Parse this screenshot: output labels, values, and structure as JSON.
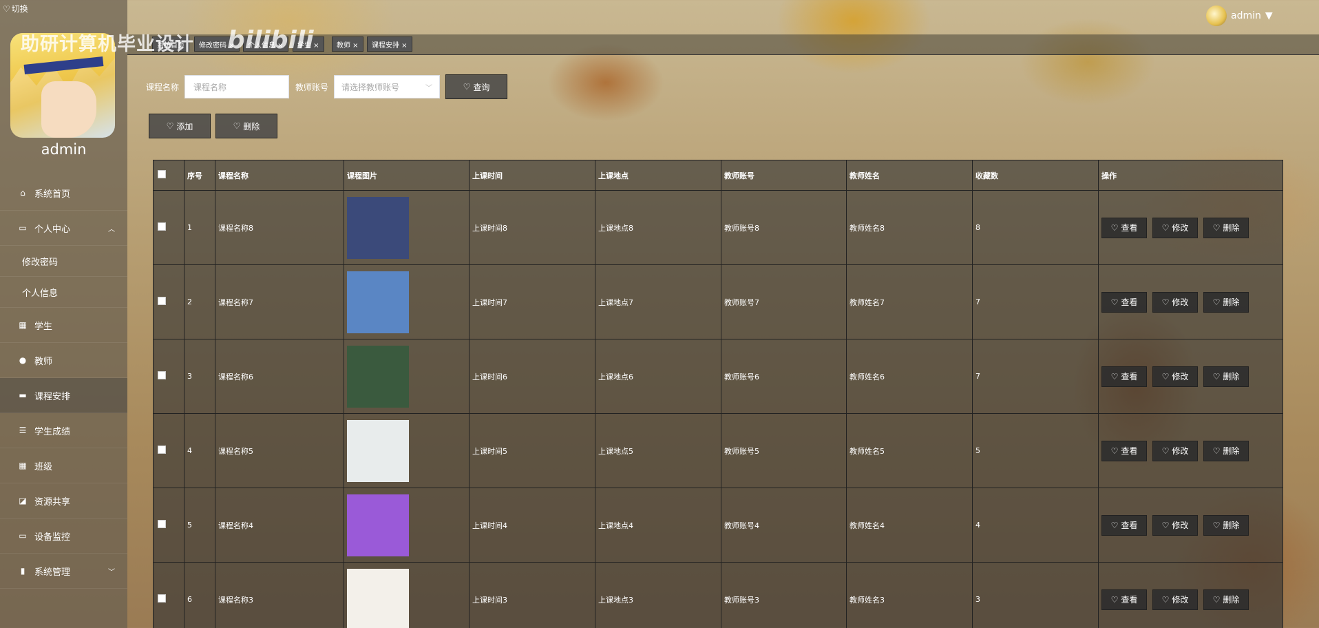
{
  "app": {
    "switch_label": "切换",
    "brand_title": "助研计算机毕业设计",
    "brand_mark": "bilibili",
    "user": "admin"
  },
  "sidebar": {
    "username": "admin",
    "items": [
      {
        "label": "系统首页",
        "icon": "home-icon"
      },
      {
        "label": "个人中心",
        "icon": "card-icon"
      },
      {
        "label": "修改密码",
        "icon": ""
      },
      {
        "label": "个人信息",
        "icon": ""
      },
      {
        "label": "学生",
        "icon": "grid-icon"
      },
      {
        "label": "教师",
        "icon": "person-icon"
      },
      {
        "label": "课程安排",
        "icon": "chat-icon"
      },
      {
        "label": "学生成绩",
        "icon": "sliders-icon"
      },
      {
        "label": "班级",
        "icon": "grid-icon"
      },
      {
        "label": "资源共享",
        "icon": "chart-icon"
      },
      {
        "label": "设备监控",
        "icon": "monitor-icon"
      },
      {
        "label": "系统管理",
        "icon": "bar-icon"
      }
    ]
  },
  "tabs": [
    {
      "label": "系统首页"
    },
    {
      "label": "修改密码 ×"
    },
    {
      "label": "个人信息 ×"
    },
    {
      "label": "学生 ×"
    },
    {
      "label": "教师 ×"
    },
    {
      "label": "课程安排 ×"
    }
  ],
  "search": {
    "course_label": "课程名称",
    "course_placeholder": "课程名称",
    "teacher_label": "教师账号",
    "teacher_placeholder": "请选择教师账号",
    "query_button": "查询"
  },
  "actions": {
    "add": "添加",
    "delete": "删除"
  },
  "table": {
    "columns": [
      "序号",
      "课程名称",
      "课程图片",
      "上课时间",
      "上课地点",
      "教师账号",
      "教师姓名",
      "收藏数",
      "操作"
    ],
    "rows": [
      {
        "no": "1",
        "name": "课程名称8",
        "time": "上课时间8",
        "place": "上课地点8",
        "account": "教师账号8",
        "teacher": "教师姓名8",
        "fav": "8"
      },
      {
        "no": "2",
        "name": "课程名称7",
        "time": "上课时间7",
        "place": "上课地点7",
        "account": "教师账号7",
        "teacher": "教师姓名7",
        "fav": "7"
      },
      {
        "no": "3",
        "name": "课程名称6",
        "time": "上课时间6",
        "place": "上课地点6",
        "account": "教师账号6",
        "teacher": "教师姓名6",
        "fav": "7"
      },
      {
        "no": "4",
        "name": "课程名称5",
        "time": "上课时间5",
        "place": "上课地点5",
        "account": "教师账号5",
        "teacher": "教师姓名5",
        "fav": "5"
      },
      {
        "no": "5",
        "name": "课程名称4",
        "time": "上课时间4",
        "place": "上课地点4",
        "account": "教师账号4",
        "teacher": "教师姓名4",
        "fav": "4"
      },
      {
        "no": "6",
        "name": "课程名称3",
        "time": "上课时间3",
        "place": "上课地点3",
        "account": "教师账号3",
        "teacher": "教师姓名3",
        "fav": "3"
      }
    ],
    "row_actions": {
      "view": "查看",
      "edit": "修改",
      "delete": "删除"
    }
  },
  "course_image_colors": [
    "#3b4a7a",
    "#5a86c4",
    "#3a5a3e",
    "#e8ecec",
    "#9a5ad8",
    "#f3f0ea"
  ]
}
